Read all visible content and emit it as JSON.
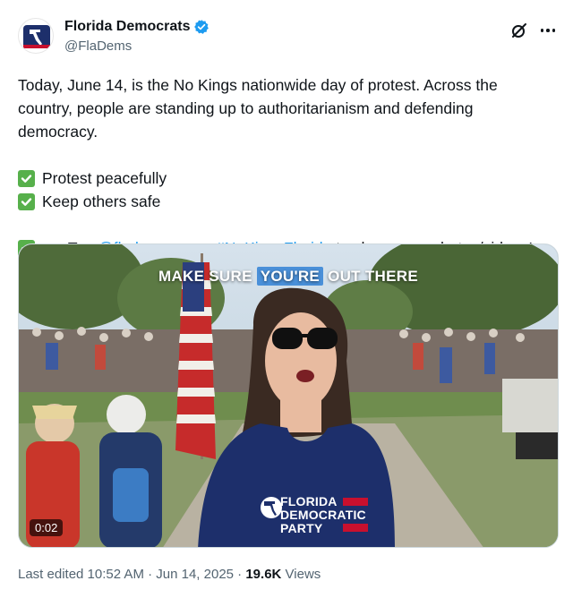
{
  "author": {
    "display_name": "Florida Democrats",
    "handle": "@FlaDems",
    "avatar_icon": "florida-democrats-logo",
    "verified_icon": "verified-badge-icon"
  },
  "tweet": {
    "paragraph": "Today, June 14, is the No Kings nationwide day of protest. Across the country, people are standing up to authoritarianism and defending democracy.",
    "items": [
      {
        "icon": "check-mark-button",
        "text": "Protest peacefully"
      },
      {
        "icon": "check-mark-button",
        "text": "Keep others safe"
      }
    ],
    "tag_line": {
      "icon": "check-mark-button",
      "prefix": "Tag ",
      "mention": "@fladems",
      "middle": " + use ",
      "hashtag": "#NoKingsFlorida",
      "suffix": " to share your photos/videos!"
    }
  },
  "video": {
    "caption_before": "MAKE SURE ",
    "caption_highlight": "YOU'RE",
    "caption_after": " OUT THERE",
    "shirt_line1": "FLORIDA",
    "shirt_line2": "DEMOCRATIC",
    "shirt_line3": "PARTY",
    "duration": "0:02"
  },
  "meta": {
    "edited": "Last edited 10:52 AM · Jun 14, 2025 · ",
    "views_count": "19.6K",
    "views_label": " Views"
  },
  "colors": {
    "link": "#1d9bf0",
    "secondary_text": "#536471",
    "check_green": "#57b04b",
    "shirt_navy": "#1d2f6b"
  }
}
